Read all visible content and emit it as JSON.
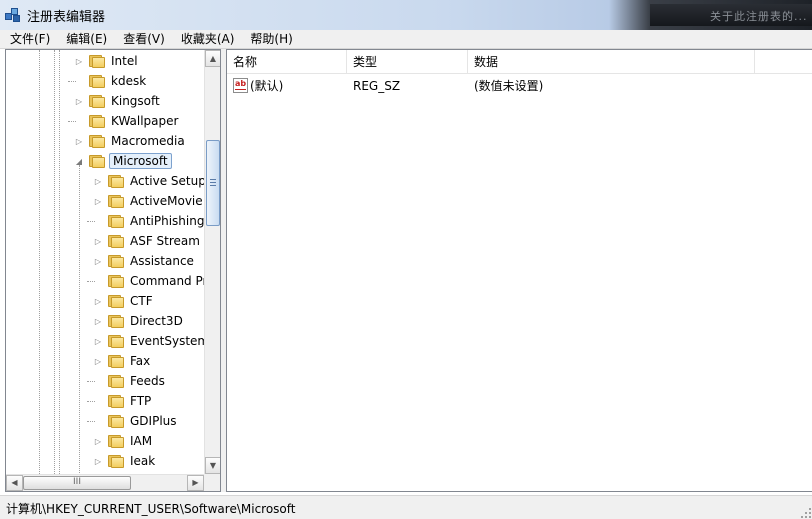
{
  "window": {
    "title": "注册表编辑器",
    "blurred_text": "关于此注册表的..."
  },
  "menu": [
    "文件(F)",
    "编辑(E)",
    "查看(V)",
    "收藏夹(A)",
    "帮助(H)"
  ],
  "tree": {
    "items": [
      {
        "label": "Intel",
        "level": 1,
        "expander": "collapsed"
      },
      {
        "label": "kdesk",
        "level": 1,
        "expander": "none"
      },
      {
        "label": "Kingsoft",
        "level": 1,
        "expander": "collapsed"
      },
      {
        "label": "KWallpaper",
        "level": 1,
        "expander": "none"
      },
      {
        "label": "Macromedia",
        "level": 1,
        "expander": "collapsed"
      },
      {
        "label": "Microsoft",
        "level": 1,
        "expander": "expanded",
        "selected": true
      },
      {
        "label": "Active Setup",
        "level": 2,
        "expander": "collapsed"
      },
      {
        "label": "ActiveMovie",
        "level": 2,
        "expander": "collapsed"
      },
      {
        "label": "AntiPhishing",
        "level": 2,
        "expander": "none"
      },
      {
        "label": "ASF Stream D",
        "level": 2,
        "expander": "collapsed"
      },
      {
        "label": "Assistance",
        "level": 2,
        "expander": "collapsed"
      },
      {
        "label": "Command Pr",
        "level": 2,
        "expander": "none"
      },
      {
        "label": "CTF",
        "level": 2,
        "expander": "collapsed"
      },
      {
        "label": "Direct3D",
        "level": 2,
        "expander": "collapsed"
      },
      {
        "label": "EventSystem",
        "level": 2,
        "expander": "collapsed"
      },
      {
        "label": "Fax",
        "level": 2,
        "expander": "collapsed"
      },
      {
        "label": "Feeds",
        "level": 2,
        "expander": "none"
      },
      {
        "label": "FTP",
        "level": 2,
        "expander": "none"
      },
      {
        "label": "GDIPlus",
        "level": 2,
        "expander": "none"
      },
      {
        "label": "IAM",
        "level": 2,
        "expander": "collapsed"
      },
      {
        "label": "Ieak",
        "level": 2,
        "expander": "collapsed"
      }
    ],
    "hscroll_grip": "III"
  },
  "list": {
    "columns": [
      "名称",
      "类型",
      "数据"
    ],
    "rows": [
      {
        "name": "(默认)",
        "type": "REG_SZ",
        "data": "(数值未设置)",
        "icon": "ab-string-icon"
      }
    ]
  },
  "status": {
    "path": "计算机\\HKEY_CURRENT_USER\\Software\\Microsoft"
  }
}
